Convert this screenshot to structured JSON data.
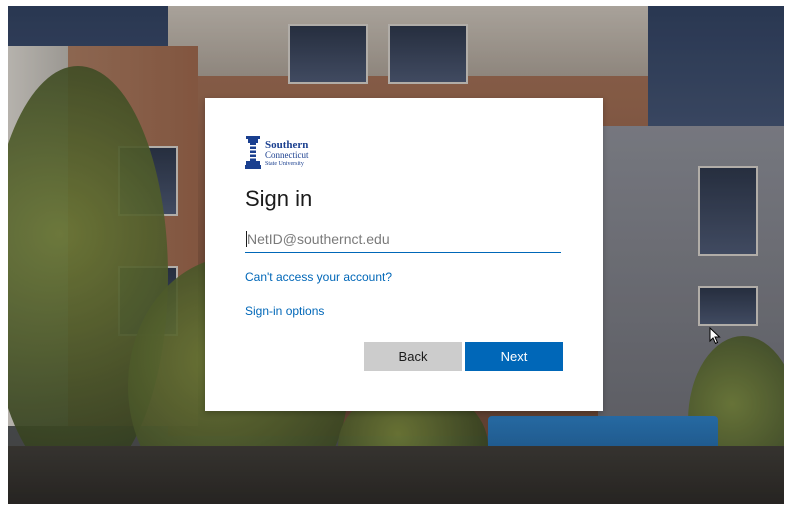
{
  "brand": {
    "name_line1": "Southern",
    "name_line2": "Connecticut",
    "name_line3": "State University",
    "color": "#1a3f8f"
  },
  "signin": {
    "title": "Sign in",
    "email_placeholder": "NetID@southernct.edu",
    "email_value": "",
    "cant_access_link": "Can't access your account?",
    "signin_options_link": "Sign-in options",
    "back_label": "Back",
    "next_label": "Next"
  },
  "colors": {
    "accent": "#0067b8",
    "back_button": "#cccccc",
    "card": "#ffffff"
  },
  "icons": {
    "logo": "torch-logo-icon",
    "cursor": "mouse-pointer-icon"
  }
}
